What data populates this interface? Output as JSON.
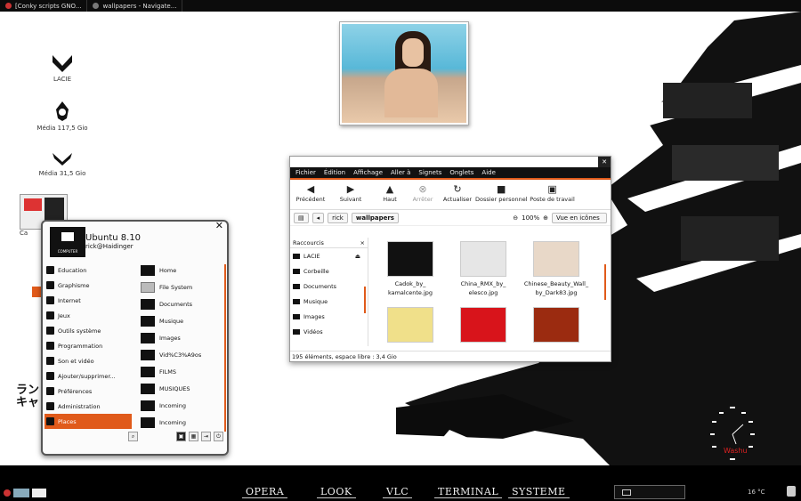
{
  "topbar": {
    "tasks": [
      "[Conky scripts GNO...",
      "wallpapers - Navigate..."
    ]
  },
  "desktop": {
    "icons": [
      {
        "label": "LACIE",
        "icon": "lacie-drive-icon"
      },
      {
        "label": "Média 117,5 Gio",
        "icon": "media-drive-icon"
      },
      {
        "label": "Média 31,5 Gio",
        "icon": "media-drive-icon"
      },
      {
        "label": "Ca",
        "icon": "screenshot-icon"
      }
    ],
    "side_text": [
      "ラン",
      "キャ"
    ]
  },
  "file_manager": {
    "menu": [
      "Fichier",
      "Édition",
      "Affichage",
      "Aller à",
      "Signets",
      "Onglets",
      "Aide"
    ],
    "toolbar": [
      {
        "label": "Précédent",
        "icon": "back-arrow-icon",
        "glyph": "◀",
        "disabled": false
      },
      {
        "label": "Suivant",
        "icon": "forward-arrow-icon",
        "glyph": "▶",
        "disabled": false
      },
      {
        "label": "Haut",
        "icon": "up-arrow-icon",
        "glyph": "▲",
        "disabled": false
      },
      {
        "label": "Arrêter",
        "icon": "stop-icon",
        "glyph": "⊗",
        "disabled": true
      },
      {
        "label": "Actualiser",
        "icon": "reload-icon",
        "glyph": "↻",
        "disabled": false
      },
      {
        "label": "Dossier personnel",
        "icon": "home-folder-icon",
        "glyph": "■",
        "disabled": false
      },
      {
        "label": "Poste de travail",
        "icon": "computer-icon",
        "glyph": "▣",
        "disabled": false
      }
    ],
    "path": [
      "rick",
      "wallpapers"
    ],
    "zoom": "100%",
    "view": "Vue en icônes",
    "sidebar_title": "Raccourcis",
    "sidebar_items": [
      "LACIE",
      "Corbeille",
      "Documents",
      "Musique",
      "Images",
      "Vidéos"
    ],
    "files": [
      {
        "name": "Cadok_by_ kamalcente.jpg",
        "thumb": "#111111"
      },
      {
        "name": "China_RMX_by_ elesco.jpg",
        "thumb": "#e6e6e6"
      },
      {
        "name": "Chinese_Beauty_Wall_ by_Dark83.jpg",
        "thumb": "#e8d8c8"
      },
      {
        "name": "",
        "thumb": "#f0e08a"
      },
      {
        "name": "",
        "thumb": "#d8141b"
      },
      {
        "name": "",
        "thumb": "#9b2b10"
      }
    ],
    "status": "195 éléments, espace libre : 3,4 Gio"
  },
  "start_menu": {
    "computer_label": "COMPUTER",
    "os": "Ubuntu 8.10",
    "user": "rick@Haidinger",
    "categories": [
      "Education",
      "Graphisme",
      "Internet",
      "Jeux",
      "Outils système",
      "Programmation",
      "Son et vidéo",
      "Ajouter/supprimer...",
      "Préférences",
      "Administration",
      "Places"
    ],
    "selected_category": "Places",
    "places": [
      {
        "label": "Home",
        "type": "home"
      },
      {
        "label": "File System",
        "type": "drive"
      },
      {
        "label": "Documents",
        "type": "folder"
      },
      {
        "label": "Musique",
        "type": "folder"
      },
      {
        "label": "Images",
        "type": "folder"
      },
      {
        "label": "Vid%C3%A9os",
        "type": "folder"
      },
      {
        "label": "FILMS",
        "type": "folder"
      },
      {
        "label": "MUSIQUES",
        "type": "folder"
      },
      {
        "label": "Incoming",
        "type": "folder"
      },
      {
        "label": "Incoming",
        "type": "folder"
      }
    ]
  },
  "dock": [
    "OPERA",
    "LOOK",
    "VLC",
    "TERMINAL",
    "SYSTEME"
  ],
  "tray": {
    "temperature": "16 °C"
  },
  "clock": {
    "label": "Washu"
  },
  "colors": {
    "accent": "#e05a1a",
    "dark": "#111111"
  }
}
